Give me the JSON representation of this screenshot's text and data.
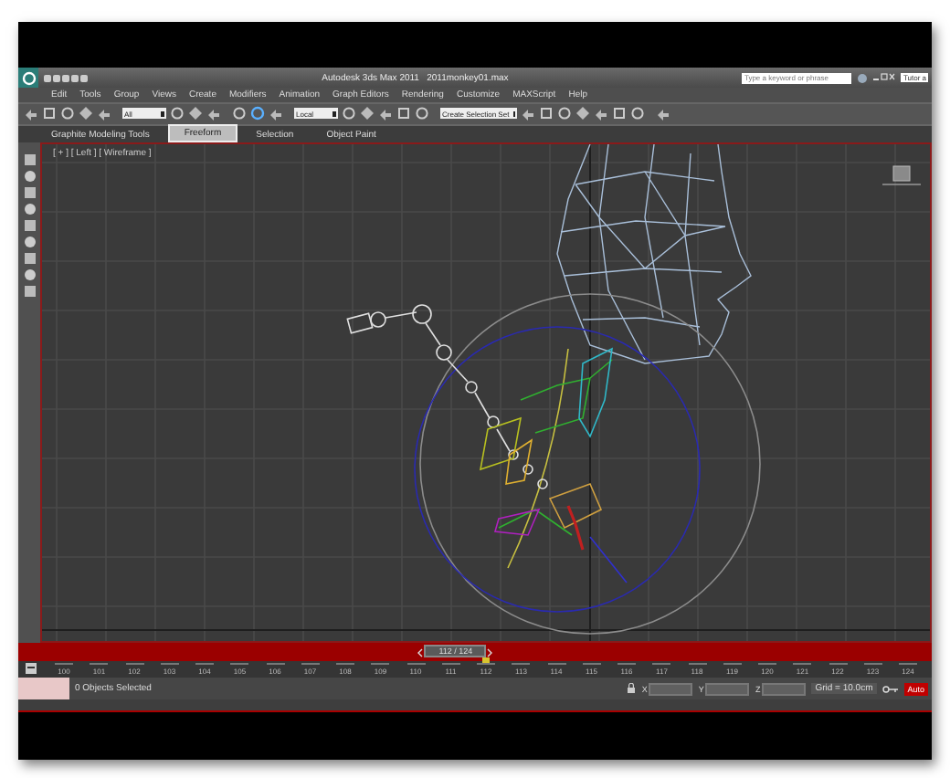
{
  "window": {
    "title": "Autodesk 3ds Max 2011",
    "file": "2011monkey01.max"
  },
  "search": {
    "placeholder": "Type a keyword or phrase"
  },
  "tooltip": "Tutor a",
  "menu": [
    "Edit",
    "Tools",
    "Group",
    "Views",
    "Create",
    "Modifiers",
    "Animation",
    "Graph Editors",
    "Rendering",
    "Customize",
    "MAXScript",
    "Help"
  ],
  "toolbar": {
    "selection_filter": "All",
    "coordinate_system": "Local",
    "selection_set": "Create Selection Set"
  },
  "ribbon_tabs": [
    {
      "label": "Graphite Modeling Tools",
      "selected": false
    },
    {
      "label": "Freeform",
      "selected": true
    },
    {
      "label": "Selection",
      "selected": false
    },
    {
      "label": "Object Paint",
      "selected": false
    }
  ],
  "viewport": {
    "label": "[ + ] [ Left ] [ Wireframe ]"
  },
  "time_slider": {
    "label": "112 / 124",
    "level": 0.47
  },
  "track_bar": {
    "ticks": [
      {
        "label": "100",
        "current": false
      },
      {
        "label": "101",
        "current": false
      },
      {
        "label": "102",
        "current": false
      },
      {
        "label": "103",
        "current": false
      },
      {
        "label": "104",
        "current": false
      },
      {
        "label": "105",
        "current": false
      },
      {
        "label": "106",
        "current": false
      },
      {
        "label": "107",
        "current": false
      },
      {
        "label": "108",
        "current": false
      },
      {
        "label": "109",
        "current": false
      },
      {
        "label": "110",
        "current": false
      },
      {
        "label": "111",
        "current": false
      },
      {
        "label": "112",
        "current": true
      },
      {
        "label": "113",
        "current": false
      },
      {
        "label": "114",
        "current": false
      },
      {
        "label": "115",
        "current": false
      },
      {
        "label": "116",
        "current": false
      },
      {
        "label": "117",
        "current": false
      },
      {
        "label": "118",
        "current": false
      },
      {
        "label": "119",
        "current": false
      },
      {
        "label": "120",
        "current": false
      },
      {
        "label": "121",
        "current": false
      },
      {
        "label": "122",
        "current": false
      },
      {
        "label": "123",
        "current": false
      },
      {
        "label": "124",
        "current": false
      }
    ]
  },
  "status": {
    "message": "0 Objects Selected",
    "coords": [
      "X",
      "Y",
      "Z"
    ],
    "grid": "Grid = 10.0cm",
    "auto_key": "Auto"
  }
}
